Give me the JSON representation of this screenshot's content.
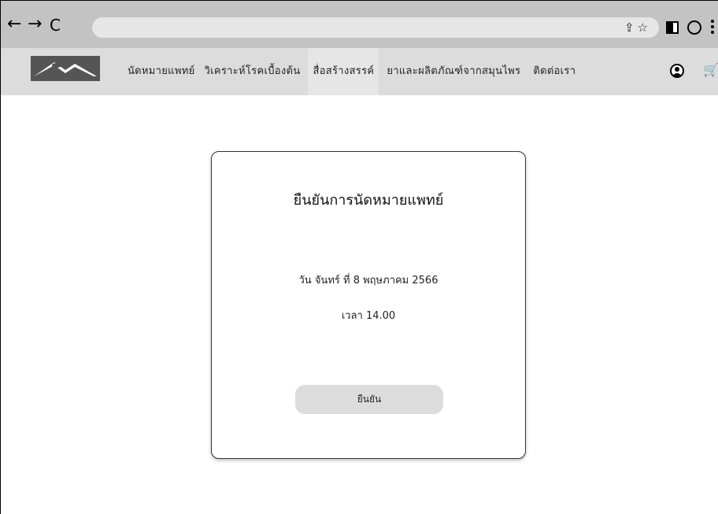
{
  "browser": {
    "back_glyph": "←",
    "forward_glyph": "→",
    "reload_glyph": "C",
    "address_icons": "⇪☆"
  },
  "nav": {
    "items": [
      {
        "label": "นัดหมายแพทย์"
      },
      {
        "label": "วิเคราะห์โรคเบื้องต้น"
      },
      {
        "label": "สื่อสร้างสรรค์"
      },
      {
        "label": "ยาและผลิตภัณฑ์จากสมุนไพร"
      },
      {
        "label": "ติดต่อเรา"
      }
    ],
    "active_index": 2,
    "cart_glyph": "🛒"
  },
  "card": {
    "title": "ยืนยันการนัดหมายแพทย์",
    "date": "วัน จันทร์ ที่ 8 พฤษภาคม 2566",
    "time": "เวลา 14.00",
    "button_label": "ยืนยัน"
  },
  "colors": {
    "chrome_bg": "#c3c3c3",
    "header_bg": "#dcdcdc",
    "button_bg": "#dcdcdc"
  }
}
